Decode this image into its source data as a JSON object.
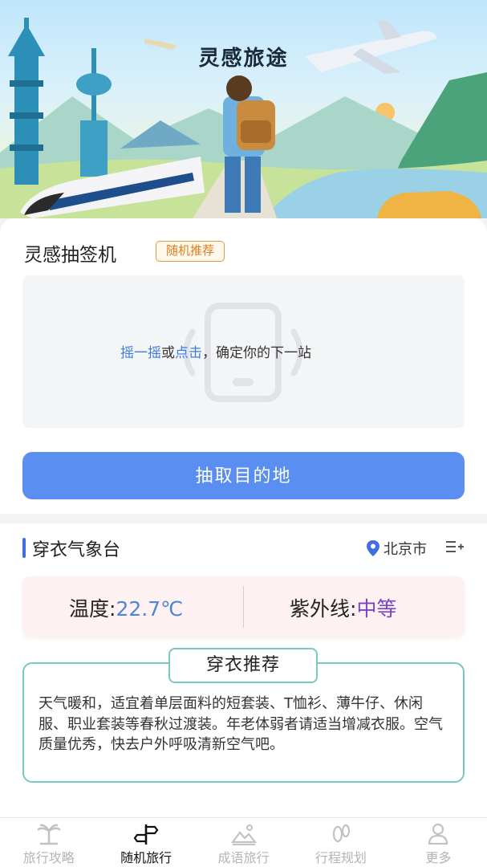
{
  "hero": {
    "title": "灵感旅途"
  },
  "lottery": {
    "title": "灵感抽签机",
    "badge": "随机推荐",
    "hint_shake": "摇一摇",
    "hint_or": "或",
    "hint_click": "点击",
    "hint_rest": "，确定你的下一站",
    "draw_button": "抽取目的地"
  },
  "weather": {
    "title": "穿衣气象台",
    "location": "北京市",
    "temp_label": "温度:",
    "temp_value": "22.7℃",
    "uv_label": "紫外线:",
    "uv_value": "中等",
    "recommend_title": "穿衣推荐",
    "recommend_text": "天气暖和，适宜着单层面料的短套装、T恤衫、薄牛仔、休闲服、职业套装等春秋过渡装。年老体弱者请适当增减衣服。空气质量优秀，快去户外呼吸清新空气吧。"
  },
  "nav": {
    "items": [
      {
        "label": "旅行攻略",
        "icon": "palm-tree-icon",
        "active": false
      },
      {
        "label": "随机旅行",
        "icon": "signpost-icon",
        "active": true
      },
      {
        "label": "成语旅行",
        "icon": "landscape-icon",
        "active": false
      },
      {
        "label": "行程规划",
        "icon": "footprint-icon",
        "active": false
      },
      {
        "label": "更多",
        "icon": "user-icon",
        "active": false
      }
    ]
  },
  "colors": {
    "accent": "#5b8ef1",
    "badge": "#d97f1a",
    "teal": "#79c8c0",
    "uv": "#7a42c9",
    "temp": "#4f84d6"
  }
}
